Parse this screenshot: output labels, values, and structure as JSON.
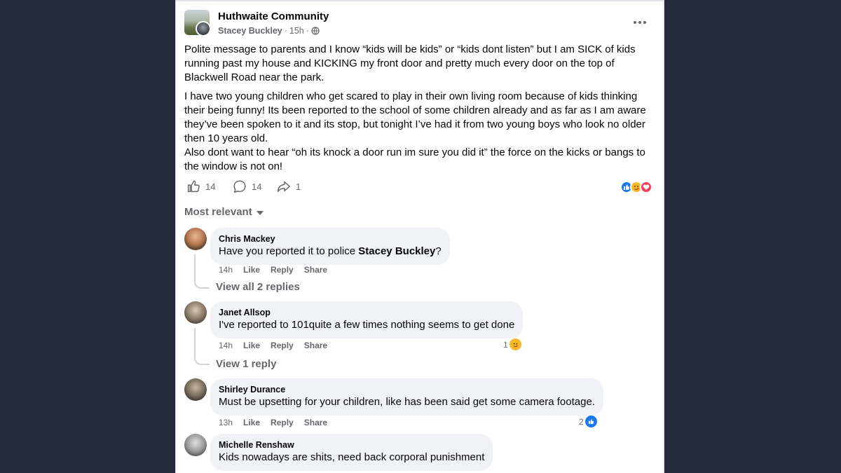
{
  "post": {
    "group_name": "Huthwaite Community",
    "author": "Stacey Buckley",
    "separator": "·",
    "time": "15h",
    "paragraphs": [
      "Polite message to parents and I know “kids will be kids” or “kids dont listen” but I am SICK of kids running past my house and KICKING my front door and pretty much every door on the top of Blackwell Road near the park.",
      "I have two young children who get scared to play in their own living room because of kids thinking their being funny! Its been reported to the school of some children already and as far as I am aware they’ve been spoken to it and its stop, but tonight I’ve had it from two young boys who look no older then 10 years old.",
      "Also dont want to hear “oh its knock a door run im sure you did it” the force on the kicks or bangs to the window is not on!"
    ],
    "like_count": "14",
    "comment_count": "14",
    "share_count": "1",
    "reaction_icons": [
      "like-reaction-icon",
      "care-reaction-icon",
      "love-reaction-icon"
    ]
  },
  "comments_header": {
    "sort_label": "Most relevant"
  },
  "comments": [
    {
      "name": "Chris Mackey",
      "text": "Have you reported it to police ",
      "mention": "Stacey Buckley",
      "text_after": "?",
      "time": "14h",
      "like": "Like",
      "reply": "Reply",
      "share": "Share",
      "replies_label": "View all 2 replies"
    },
    {
      "name": "Janet Allsop",
      "text": "I've reported to 101quite a few times nothing seems to get done",
      "time": "14h",
      "like": "Like",
      "reply": "Reply",
      "share": "Share",
      "reaction_count": "1",
      "replies_label": "View 1 reply"
    },
    {
      "name": "Shirley Durance",
      "text": "Must be upsetting for your children, like has been said get some camera footage.",
      "time": "13h",
      "like": "Like",
      "reply": "Reply",
      "share": "Share",
      "reaction_count": "2"
    },
    {
      "name": "Michelle Renshaw",
      "text": "Kids nowadays are shits, need back corporal punishment"
    }
  ],
  "colors": {
    "background": "#232b3a",
    "card": "#ffffff",
    "bubble": "#f0f2f5",
    "secondary_text": "#65676b",
    "like_blue": "#1877f2",
    "love_red": "#f33e58",
    "care_yellow": "#f7b928"
  }
}
